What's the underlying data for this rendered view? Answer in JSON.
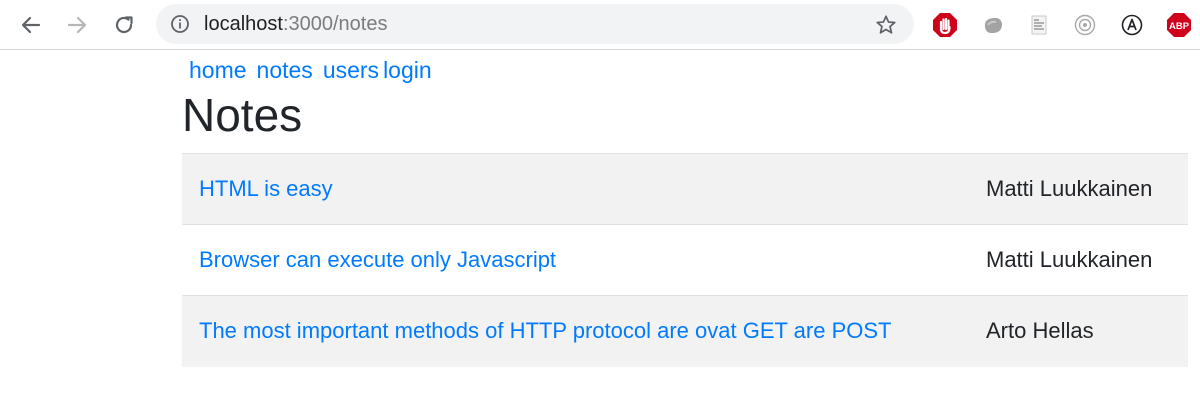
{
  "browser": {
    "url_host": "localhost",
    "url_path": ":3000/notes",
    "icons": {
      "back": "arrow-left-icon",
      "forward": "arrow-right-icon",
      "reload": "reload-icon",
      "info": "info-icon",
      "bookmark": "star-icon"
    },
    "extensions": [
      {
        "name": "adblock-hand-extension-icon",
        "color": "#d0021b"
      },
      {
        "name": "grey-blob-extension-icon",
        "color": "#9a9a9a"
      },
      {
        "name": "notes-extension-icon",
        "color": "#9a9a9a"
      },
      {
        "name": "target-extension-icon",
        "color": "#9a9a9a"
      },
      {
        "name": "letter-a-extension-icon",
        "color": "#202124"
      },
      {
        "name": "abp-extension-icon",
        "color": "#d0021b",
        "label": "ABP"
      }
    ]
  },
  "nav": {
    "home": "home",
    "notes": "notes",
    "users": "users",
    "login": "login"
  },
  "page": {
    "title": "Notes"
  },
  "notes": [
    {
      "content": "HTML is easy",
      "author": "Matti Luukkainen"
    },
    {
      "content": "Browser can execute only Javascript",
      "author": "Matti Luukkainen"
    },
    {
      "content": "The most important methods of HTTP protocol are ovat GET are POST",
      "author": "Arto Hellas"
    }
  ],
  "colors": {
    "link": "#007bff",
    "text": "#212529",
    "stripe": "#f2f2f2",
    "border": "#dee2e6"
  }
}
